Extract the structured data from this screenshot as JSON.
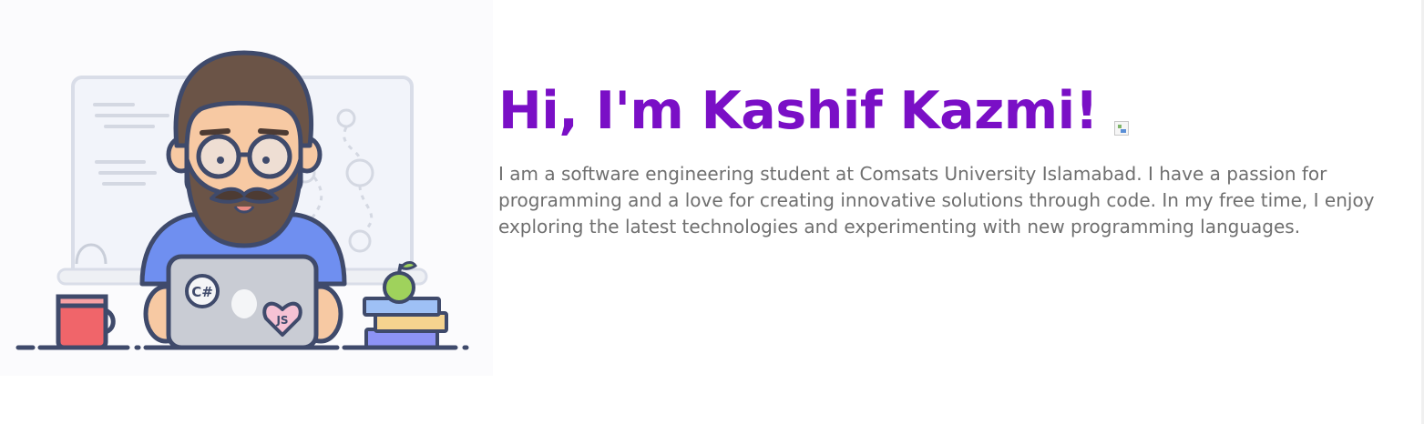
{
  "hero": {
    "heading": "Hi, I'm Kashif Kazmi!",
    "bio": "I am a software engineering student at Comsats University Islamabad. I have a passion for programming and a love for creating innovative solutions through code. In my free time, I enjoy exploring the latest technologies and experimenting with new programming languages.",
    "illustration": {
      "laptop_sticker_left": "C#",
      "laptop_sticker_right": "JS"
    }
  },
  "colors": {
    "heading": "#7a0fc6",
    "bio_text": "#6f6f6f",
    "illustration_outline": "#3f4a6b",
    "shirt": "#6f8ff0",
    "mug": "#f0656a",
    "apple": "#9fd25c"
  }
}
